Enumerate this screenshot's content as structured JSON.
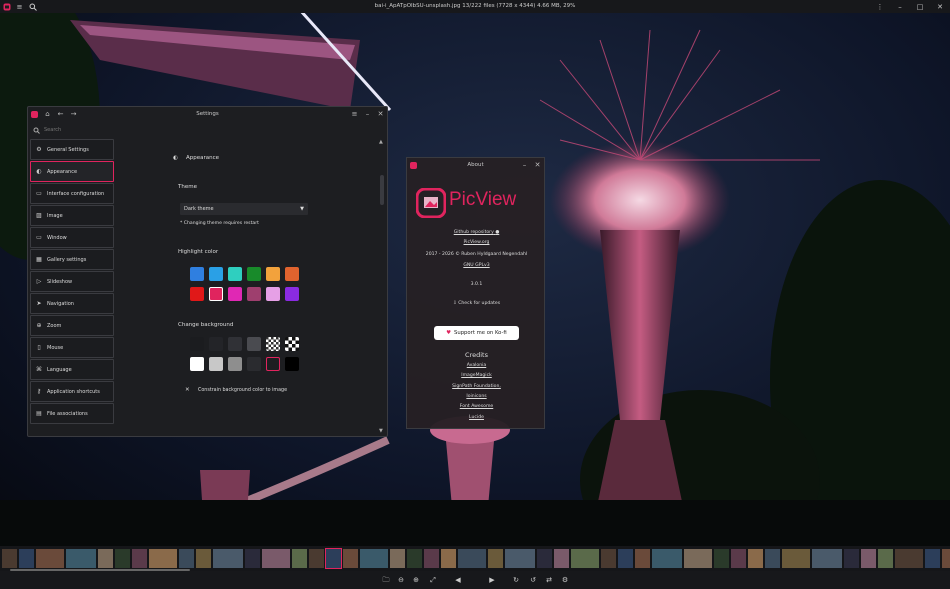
{
  "titlebar": {
    "title": "bai-i_ApATpOIbSU-unsplash.jpg 13/222 files (7728 x 4344) 4.66 MB, 29%",
    "icons": [
      "picview-logo-icon",
      "menu-icon",
      "search-icon",
      "more-icon",
      "minimize-icon",
      "maximize-icon",
      "close-icon"
    ]
  },
  "settings": {
    "title": "Settings",
    "search_placeholder": "Search",
    "nav": [
      {
        "label": "General Settings",
        "icon": "gear-icon"
      },
      {
        "label": "Appearance",
        "icon": "palette-icon"
      },
      {
        "label": "Interface configuration",
        "icon": "window-icon"
      },
      {
        "label": "Image",
        "icon": "image-icon"
      },
      {
        "label": "Window",
        "icon": "window-icon"
      },
      {
        "label": "Gallery settings",
        "icon": "gallery-icon"
      },
      {
        "label": "Slideshow",
        "icon": "play-icon"
      },
      {
        "label": "Navigation",
        "icon": "navigation-icon"
      },
      {
        "label": "Zoom",
        "icon": "zoom-icon"
      },
      {
        "label": "Mouse",
        "icon": "mouse-icon"
      },
      {
        "label": "Language",
        "icon": "language-icon"
      },
      {
        "label": "Application shortcuts",
        "icon": "key-icon"
      },
      {
        "label": "File associations",
        "icon": "file-icon"
      }
    ],
    "section_title": "Appearance",
    "theme_label": "Theme",
    "theme_value": "Dark theme",
    "theme_note": "* Changing theme requires restart",
    "highlight_label": "Highlight color",
    "highlight_colors": [
      "#2f7fe0",
      "#2aa0e6",
      "#2fcfbf",
      "#188a2a",
      "#f2a23c",
      "#e0632e",
      "#e01818",
      "#e0245e",
      "#e028b4",
      "#9e3f6e",
      "#e6a0e6",
      "#8a2be2"
    ],
    "highlight_selected": 7,
    "background_label": "Change background",
    "background_colors": [
      "#1b1c1f",
      "#232428",
      "#303136",
      "#4a4b50",
      "checker",
      "checker-lg",
      "#ffffff",
      "#c8c8c8",
      "#8e8e8e",
      "#2a2b2f",
      "#1d1e21",
      "#000000"
    ],
    "background_selected": 10,
    "constrain_label": "Constrain background color to image"
  },
  "about": {
    "title": "About",
    "app_name": "PicView",
    "github": "Github repository",
    "website": "PicView.org",
    "copyright": "2017 - 2026 © Ruben Hyldgaard Negendahl",
    "license": "GNU GPLv3",
    "version": "3.0.1",
    "check_updates": "Check for updates",
    "kofi": "Support me on Ko-fi",
    "credits_title": "Credits",
    "credits": [
      "Avalonia",
      "ImageMagick",
      "SignPath Foundation,",
      "Ioinicons",
      "Font Awesome",
      "Lucide"
    ]
  },
  "bottombar": {
    "icons": [
      "open-file-icon",
      "zoom-out-icon",
      "zoom-in-icon",
      "fit-icon",
      "previous-icon",
      "next-icon",
      "rotate-right-icon",
      "rotate-left-icon",
      "flip-icon",
      "settings-icon"
    ]
  }
}
